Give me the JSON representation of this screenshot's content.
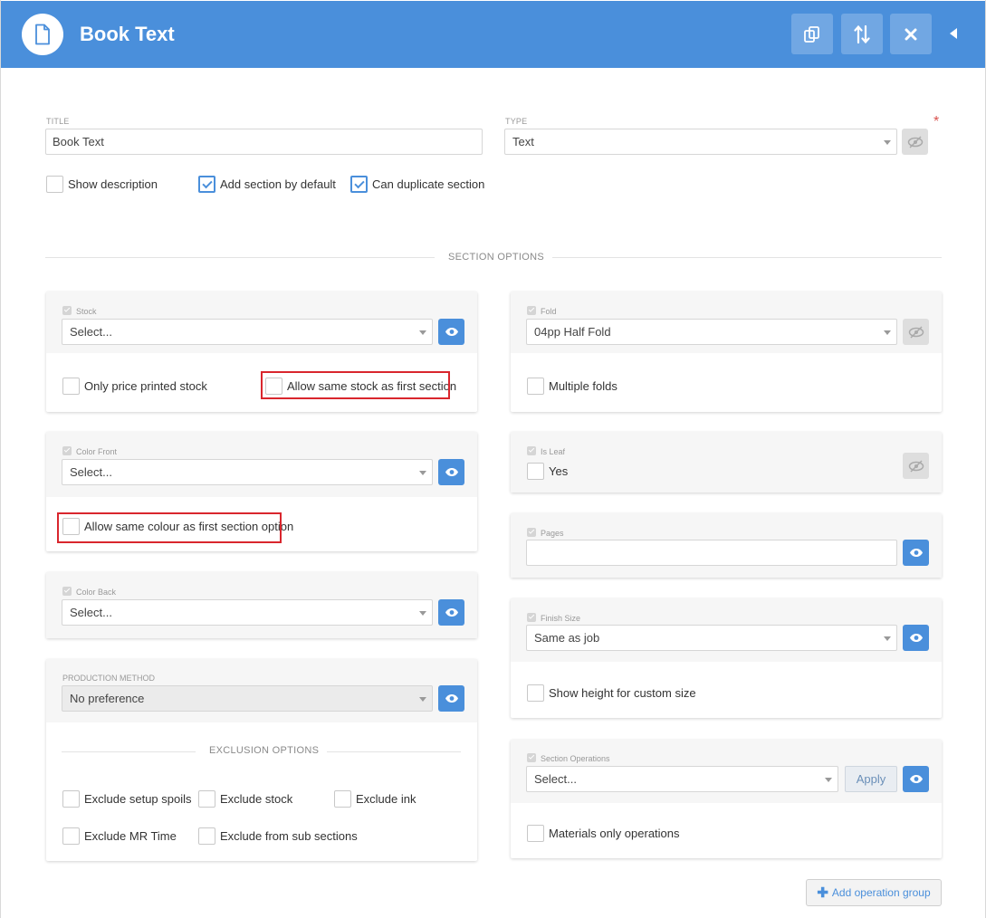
{
  "header": {
    "title": "Book Text",
    "colors": {
      "bar": "#4a8fdb"
    }
  },
  "form": {
    "title_label": "TITLE",
    "title_value": "Book Text",
    "type_label": "TYPE",
    "type_value": "Text",
    "required_mark": "*",
    "checks": {
      "show_description": "Show description",
      "add_section_default": "Add section by default",
      "can_duplicate": "Can duplicate section"
    }
  },
  "section_options": {
    "heading": "SECTION OPTIONS"
  },
  "left": {
    "stock": {
      "label": "Stock",
      "select": "Select...",
      "only_price_printed": "Only price printed stock",
      "allow_same_stock": "Allow same stock as first section"
    },
    "color_front": {
      "label": "Color Front",
      "select": "Select...",
      "allow_same_colour": "Allow same colour as first section option"
    },
    "color_back": {
      "label": "Color Back",
      "select": "Select..."
    },
    "production": {
      "label": "PRODUCTION METHOD",
      "select": "No preference",
      "exclusion_heading": "EXCLUSION OPTIONS",
      "exclude_setup_spoils": "Exclude setup spoils",
      "exclude_stock": "Exclude stock",
      "exclude_ink": "Exclude ink",
      "exclude_mr_time": "Exclude MR Time",
      "exclude_sub_sections": "Exclude from sub sections"
    }
  },
  "right": {
    "fold": {
      "label": "Fold",
      "select": "04pp Half Fold",
      "multiple_folds": "Multiple folds"
    },
    "is_leaf": {
      "label": "Is Leaf",
      "yes": "Yes"
    },
    "pages": {
      "label": "Pages",
      "value": ""
    },
    "finish_size": {
      "label": "Finish Size",
      "select": "Same as job",
      "show_height": "Show height for custom size"
    },
    "section_operations": {
      "label": "Section Operations",
      "select": "Select...",
      "apply": "Apply",
      "materials_only": "Materials only operations"
    },
    "add_operation_group": "Add operation group"
  }
}
